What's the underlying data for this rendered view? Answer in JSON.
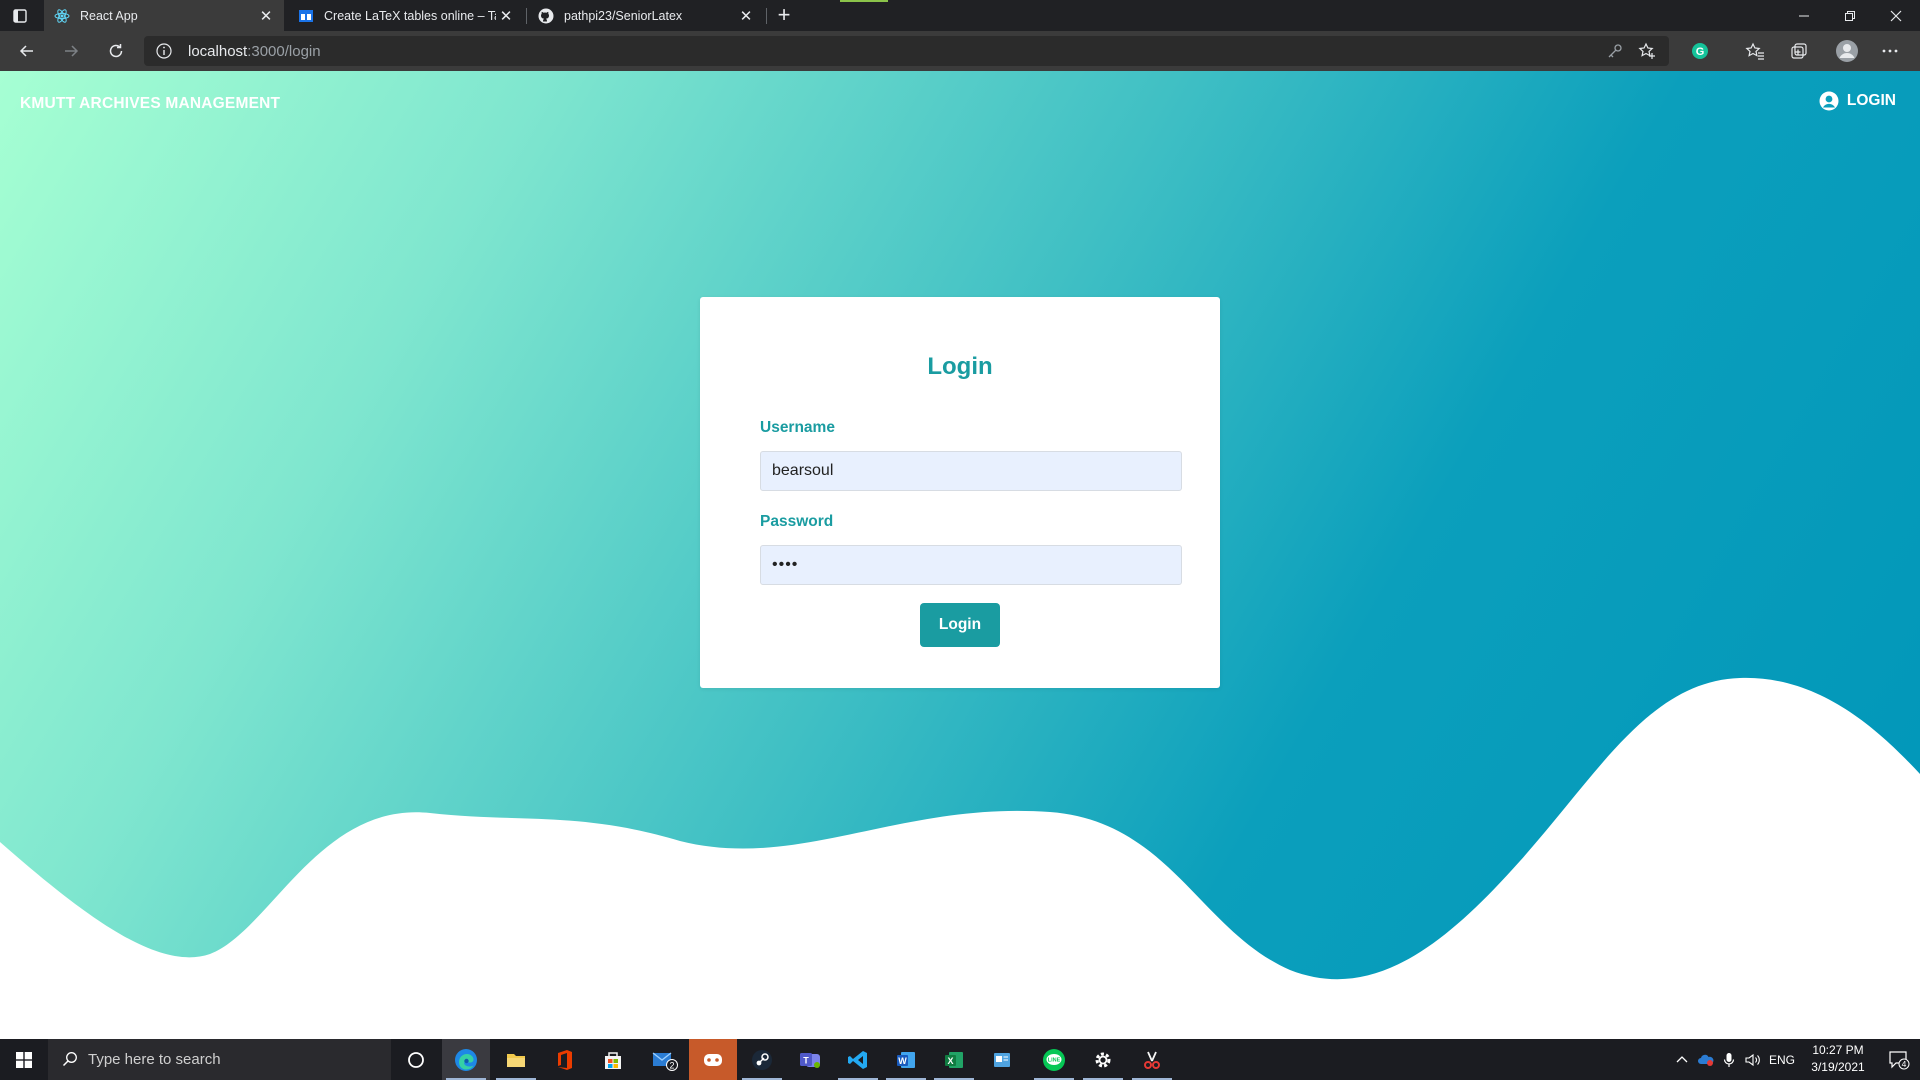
{
  "browser": {
    "tabs": [
      {
        "title": "React App",
        "active": true,
        "favicon": "react-icon"
      },
      {
        "title": "Create LaTeX tables online – Tabl",
        "active": false,
        "favicon": "tables-generator-icon"
      },
      {
        "title": "pathpi23/SeniorLatex",
        "active": false,
        "favicon": "github-icon"
      }
    ],
    "address": {
      "host": "localhost",
      "path": ":3000/login"
    }
  },
  "app": {
    "brand": "KMUTT ARCHIVES MANAGEMENT",
    "nav_login": "LOGIN",
    "colors": {
      "accent": "#1a9ca1",
      "gradient_start": "#a6ffd3",
      "gradient_end": "#0096b9"
    }
  },
  "login_form": {
    "title": "Login",
    "username_label": "Username",
    "username_value": "bearsoul",
    "password_label": "Password",
    "password_value": "••••",
    "submit_label": "Login"
  },
  "taskbar": {
    "search_placeholder": "Type here to search",
    "language": "ENG",
    "time": "10:27 PM",
    "date": "3/19/2021",
    "mail_badge": "2",
    "notification_count": "4"
  }
}
